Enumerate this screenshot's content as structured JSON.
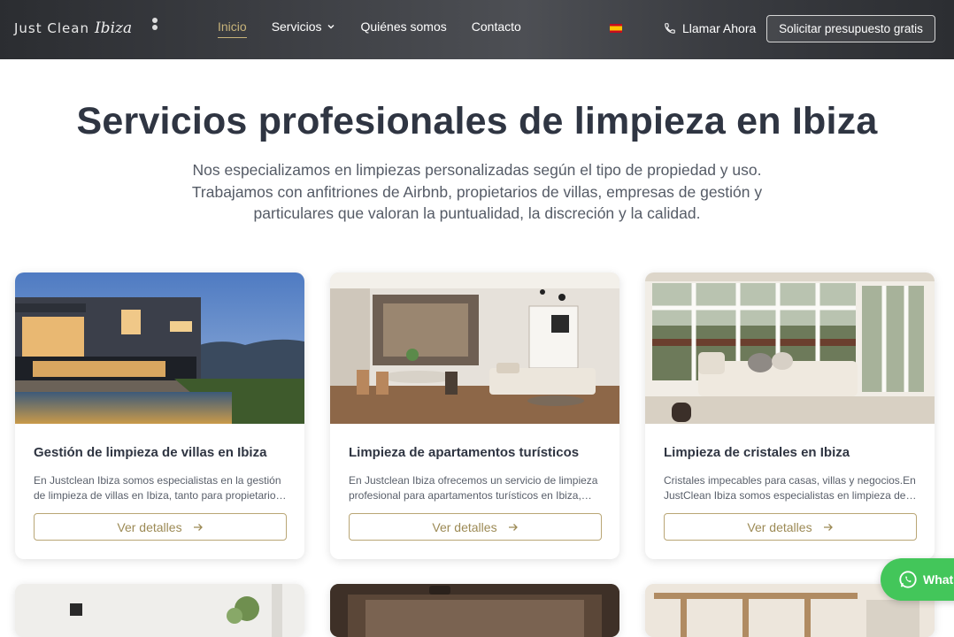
{
  "header": {
    "logo_text": "Just Clean",
    "logo_script": "Ibiza",
    "nav": [
      {
        "label": "Inicio",
        "active": true
      },
      {
        "label": "Servicios",
        "has_dropdown": true
      },
      {
        "label": "Quiénes somos"
      },
      {
        "label": "Contacto"
      }
    ],
    "call_label": "Llamar Ahora",
    "cta_label": "Solicitar presupuesto gratis",
    "accent_color": "#c7b37a"
  },
  "hero": {
    "title": "Servicios profesionales de limpieza en Ibiza",
    "subtitle": "Nos especializamos en limpiezas personalizadas según el tipo de propiedad y uso. Trabajamos con anfitriones de Airbnb, propietarios de villas, empresas de gestión y particulares que valoran la puntualidad, la discreción y la calidad."
  },
  "cards": [
    {
      "title": "Gestión de limpieza de villas en Ibiza",
      "description": "En Justclean Ibiza somos especialistas en la gestión de limpieza de villas en Ibiza, tanto para propietario…",
      "button_label": "Ver detalles"
    },
    {
      "title": "Limpieza de apartamentos turísticos",
      "description": "En Justclean Ibiza ofrecemos un servicio de limpieza profesional para apartamentos turísticos en Ibiza,…",
      "button_label": "Ver detalles"
    },
    {
      "title": "Limpieza de cristales en Ibiza",
      "description": "Cristales impecables para casas, villas y negocios.En JustClean Ibiza somos especialistas en limpieza de…",
      "button_label": "Ver detalles"
    }
  ],
  "whatsapp_label": "Whats"
}
